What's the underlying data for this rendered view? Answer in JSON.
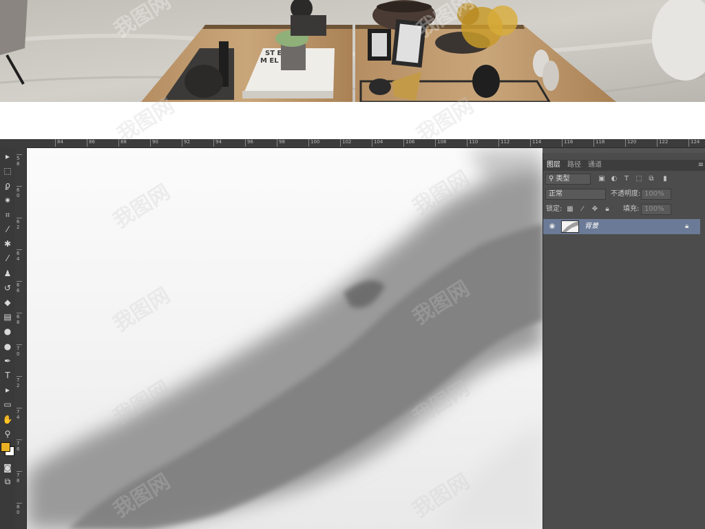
{
  "ruler": {
    "h_ticks": [
      "84",
      "86",
      "88",
      "90",
      "92",
      "94",
      "96",
      "98",
      "100",
      "102",
      "104",
      "106",
      "108",
      "110",
      "112",
      "114",
      "116",
      "118",
      "120",
      "122",
      "124"
    ],
    "v_ticks": [
      "58",
      "60",
      "62",
      "64",
      "66",
      "68",
      "70",
      "72",
      "74",
      "76",
      "78",
      "80"
    ]
  },
  "toolbar": {
    "tools": [
      {
        "name": "move-tool-icon",
        "glyph": "▸"
      },
      {
        "name": "marquee-tool-icon",
        "glyph": "⬚"
      },
      {
        "name": "lasso-tool-icon",
        "glyph": "ϼ"
      },
      {
        "name": "magic-wand-tool-icon",
        "glyph": "✷"
      },
      {
        "name": "crop-tool-icon",
        "glyph": "⌗"
      },
      {
        "name": "eyedropper-tool-icon",
        "glyph": "⁄"
      },
      {
        "name": "healing-brush-tool-icon",
        "glyph": "✱"
      },
      {
        "name": "brush-tool-icon",
        "glyph": "⁄"
      },
      {
        "name": "clone-stamp-tool-icon",
        "glyph": "♟"
      },
      {
        "name": "history-brush-tool-icon",
        "glyph": "↺"
      },
      {
        "name": "eraser-tool-icon",
        "glyph": "◆"
      },
      {
        "name": "gradient-tool-icon",
        "glyph": "▤"
      },
      {
        "name": "blur-tool-icon",
        "glyph": "●"
      },
      {
        "name": "dodge-tool-icon",
        "glyph": "●"
      },
      {
        "name": "pen-tool-icon",
        "glyph": "✒"
      },
      {
        "name": "type-tool-icon",
        "glyph": "T"
      },
      {
        "name": "path-selection-tool-icon",
        "glyph": "▸"
      },
      {
        "name": "rectangle-tool-icon",
        "glyph": "▭"
      },
      {
        "name": "hand-tool-icon",
        "glyph": "✋"
      },
      {
        "name": "zoom-tool-icon",
        "glyph": "⚲"
      }
    ],
    "foreground_color": "#e8b024",
    "background_color": "#ffffff"
  },
  "layers_panel": {
    "tabs": [
      "图层",
      "路径",
      "通道"
    ],
    "active_tab": 0,
    "filter_label": "类型",
    "blend_mode": "正常",
    "opacity_label": "不透明度:",
    "opacity_value": "100%",
    "lock_label": "锁定:",
    "fill_label": "填充:",
    "fill_value": "100%",
    "layers": [
      {
        "name": "背景",
        "visible": true,
        "locked": true
      }
    ]
  },
  "watermark": {
    "text": "我图网"
  }
}
